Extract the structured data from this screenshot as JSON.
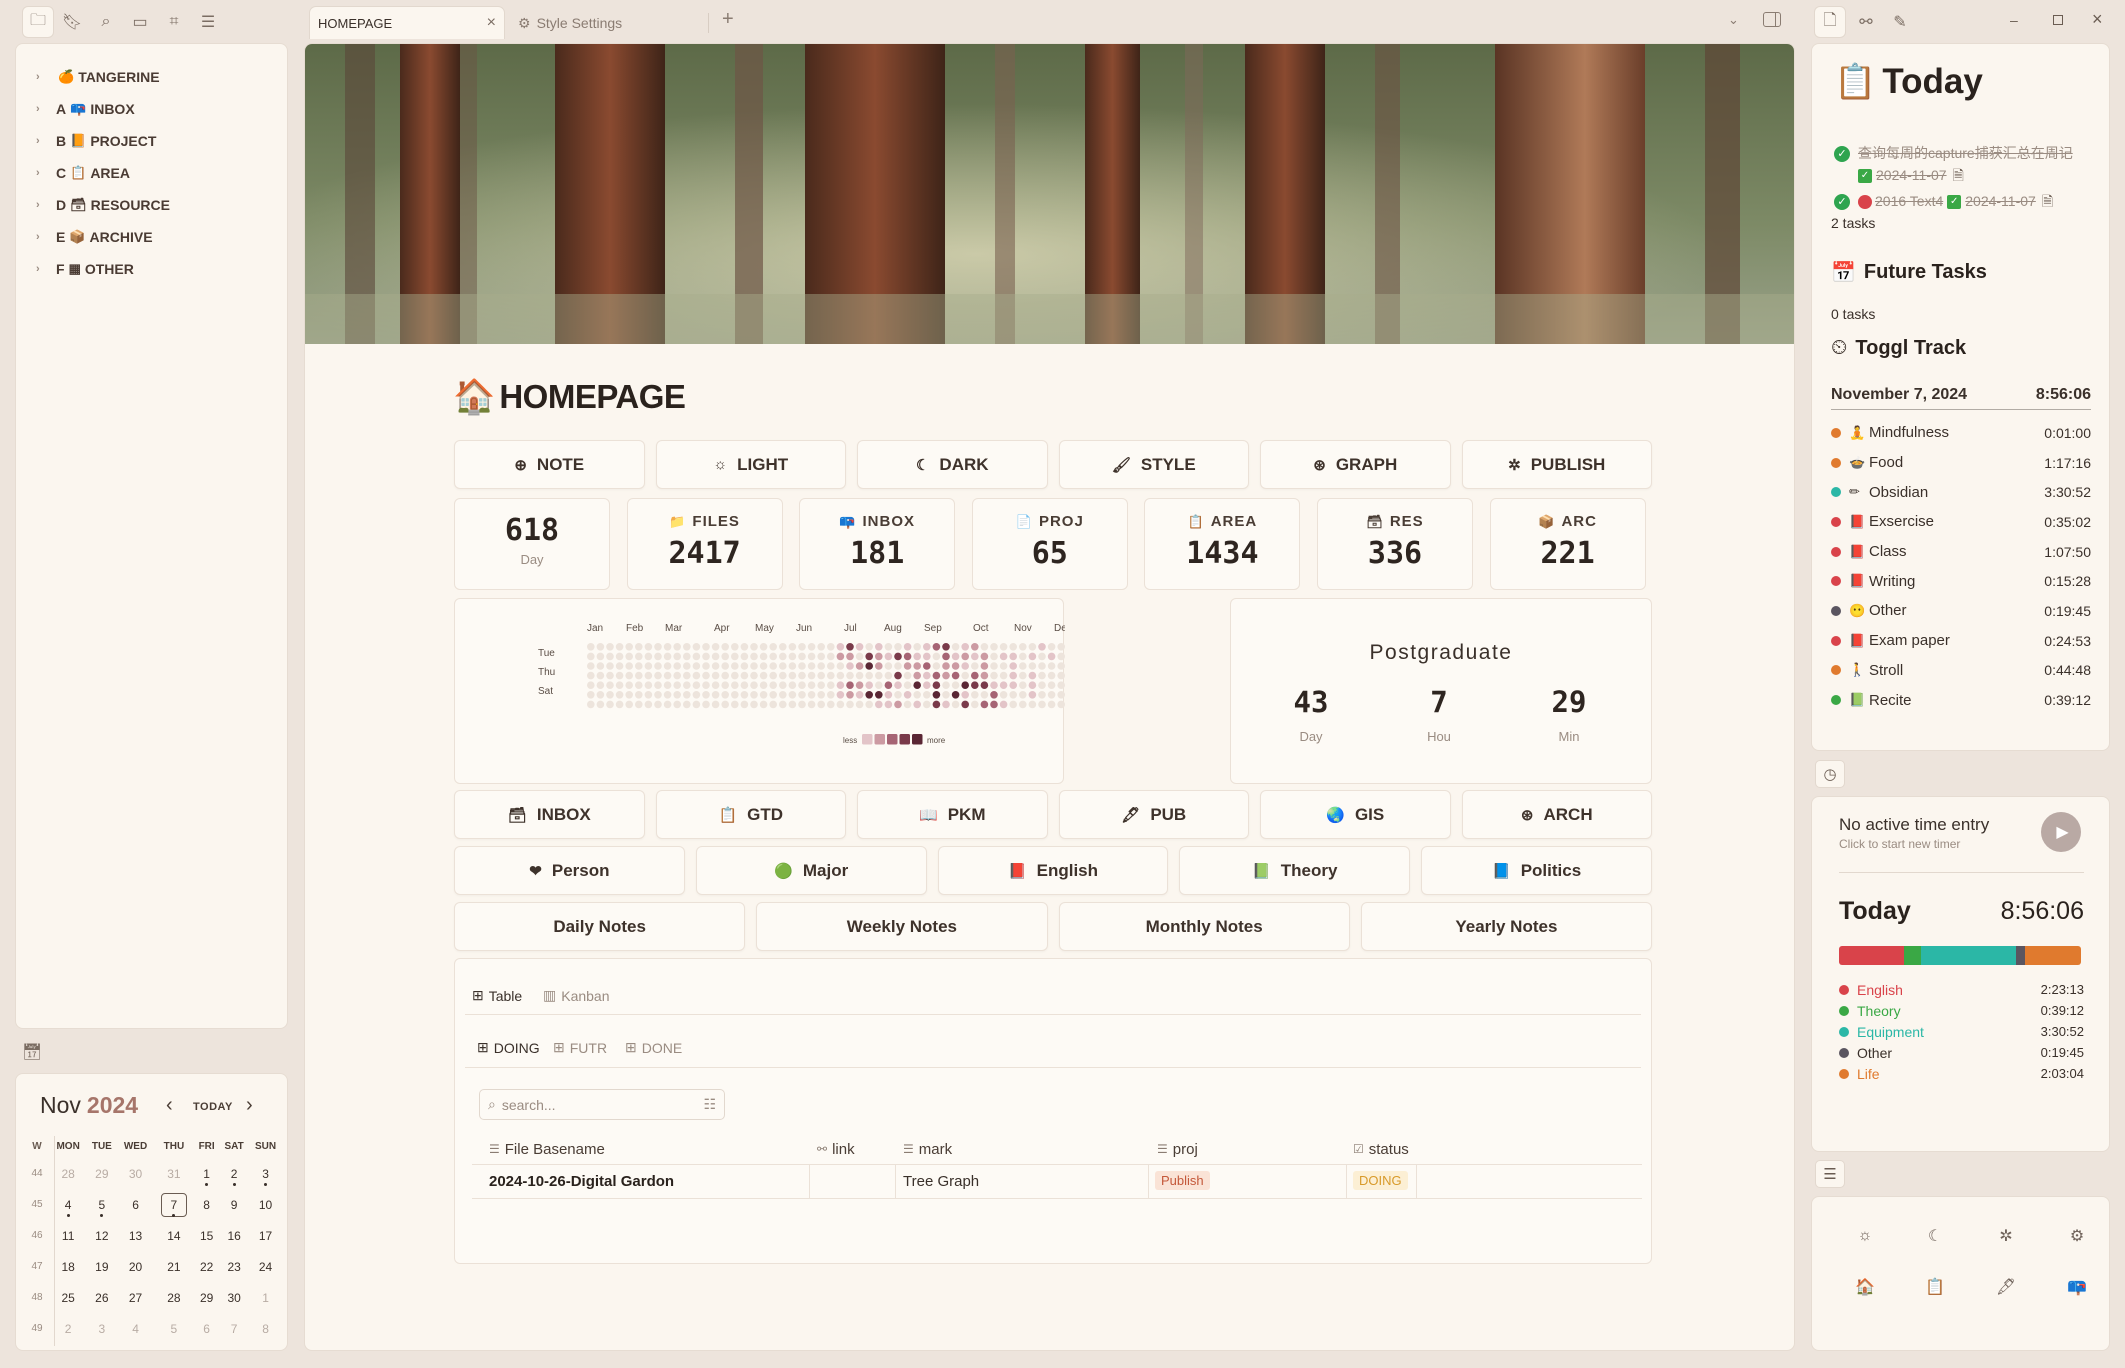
{
  "tabs": {
    "active": "HOMEPAGE",
    "inactive": "Style Settings",
    "close": "×",
    "add": "+",
    "settings_icon": "⚙"
  },
  "sidebar": {
    "items": [
      {
        "prefix": "",
        "emoji": "🍊",
        "label": "TANGERINE"
      },
      {
        "prefix": "A",
        "emoji": "📪",
        "label": "INBOX"
      },
      {
        "prefix": "B",
        "emoji": "📙",
        "label": "PROJECT"
      },
      {
        "prefix": "C",
        "emoji": "📋",
        "label": "AREA"
      },
      {
        "prefix": "D",
        "emoji": "🗃",
        "label": "RESOURCE"
      },
      {
        "prefix": "E",
        "emoji": "📦",
        "label": "ARCHIVE"
      },
      {
        "prefix": "F",
        "emoji": "▦",
        "label": "OTHER"
      }
    ]
  },
  "calendar": {
    "month": "Nov",
    "year": "2024",
    "today_btn": "TODAY",
    "week_header": "W",
    "days": [
      "MON",
      "TUE",
      "WED",
      "THU",
      "FRI",
      "SAT",
      "SUN"
    ],
    "weeks": [
      {
        "w": "44",
        "d": [
          "28",
          "29",
          "30",
          "31",
          "1",
          "2",
          "3"
        ]
      },
      {
        "w": "45",
        "d": [
          "4",
          "5",
          "6",
          "7",
          "8",
          "9",
          "10"
        ]
      },
      {
        "w": "46",
        "d": [
          "11",
          "12",
          "13",
          "14",
          "15",
          "16",
          "17"
        ]
      },
      {
        "w": "47",
        "d": [
          "18",
          "19",
          "20",
          "21",
          "22",
          "23",
          "24"
        ]
      },
      {
        "w": "48",
        "d": [
          "25",
          "26",
          "27",
          "28",
          "29",
          "30",
          "1"
        ]
      },
      {
        "w": "49",
        "d": [
          "2",
          "3",
          "4",
          "5",
          "6",
          "7",
          "8"
        ]
      }
    ]
  },
  "main": {
    "title": "HOMEPAGE",
    "title_emoji": "🏠",
    "buttons_row1": [
      {
        "icon": "⊕",
        "label": "NOTE"
      },
      {
        "icon": "☼",
        "label": "LIGHT"
      },
      {
        "icon": "☾",
        "label": "DARK"
      },
      {
        "icon": "🖌",
        "label": "STYLE"
      },
      {
        "icon": "⊛",
        "label": "GRAPH"
      },
      {
        "icon": "✲",
        "label": "PUBLISH"
      }
    ],
    "stats": [
      {
        "icon": "",
        "label": "",
        "value": "618",
        "sub": "Day"
      },
      {
        "icon": "📁",
        "label": "FILES",
        "value": "2417"
      },
      {
        "icon": "📪",
        "label": "INBOX",
        "value": "181"
      },
      {
        "icon": "📄",
        "label": "PROJ",
        "value": "65"
      },
      {
        "icon": "📋",
        "label": "AREA",
        "value": "1434"
      },
      {
        "icon": "🗃",
        "label": "RES",
        "value": "336"
      },
      {
        "icon": "📦",
        "label": "ARC",
        "value": "221"
      }
    ],
    "heatmap": {
      "months": [
        "Jan",
        "Feb",
        "Mar",
        "Apr",
        "May",
        "Jun",
        "Jul",
        "Aug",
        "Sep",
        "Oct",
        "Nov",
        "Dec"
      ],
      "rows": [
        "Tue",
        "Thu",
        "Sat"
      ],
      "less": "less",
      "more": "more"
    },
    "countdown": {
      "title": "Postgraduate",
      "items": [
        {
          "v": "43",
          "u": "Day"
        },
        {
          "v": "7",
          "u": "Hou"
        },
        {
          "v": "29",
          "u": "Min"
        }
      ]
    },
    "buttons_row2": [
      {
        "icon": "🗃",
        "label": "INBOX"
      },
      {
        "icon": "📋",
        "label": "GTD"
      },
      {
        "icon": "📖",
        "label": "PKM"
      },
      {
        "icon": "🖋",
        "label": "PUB"
      },
      {
        "icon": "🌏",
        "label": "GIS"
      },
      {
        "icon": "⊛",
        "label": "ARCH"
      }
    ],
    "buttons_row3": [
      {
        "icon": "❤",
        "label": "Person"
      },
      {
        "icon": "🟢",
        "label": "Major"
      },
      {
        "icon": "📕",
        "label": "English"
      },
      {
        "icon": "📗",
        "label": "Theory"
      },
      {
        "icon": "📘",
        "label": "Politics"
      }
    ],
    "buttons_row4": [
      {
        "label": "Daily Notes"
      },
      {
        "label": "Weekly Notes"
      },
      {
        "label": "Monthly Notes"
      },
      {
        "label": "Yearly Notes"
      }
    ],
    "views": {
      "table": "Table",
      "kanban": "Kanban"
    },
    "subtabs": [
      "DOING",
      "FUTR",
      "DONE"
    ],
    "search_placeholder": "search...",
    "columns": [
      "File Basename",
      "link",
      "mark",
      "proj",
      "status"
    ],
    "rows": [
      {
        "name": "2024-10-26-Digital Gardon",
        "link": "",
        "mark": "Tree Graph",
        "proj": "Publish",
        "status": "DOING"
      }
    ]
  },
  "right": {
    "today_title": "Today",
    "tasks": [
      {
        "text": "查询每周的capture捕获汇总在周记",
        "date": "2024-11-07"
      },
      {
        "text": "2016 Text4",
        "date": "2024-11-07"
      }
    ],
    "tasks_count": "2 tasks",
    "future_title": "Future Tasks",
    "future_count": "0 tasks",
    "toggl_title": "Toggl Track",
    "toggl_date": "November 7, 2024",
    "toggl_total": "8:56:06",
    "toggl_items": [
      {
        "c": "#e07a2e",
        "e": "🧘",
        "n": "Mindfulness",
        "t": "0:01:00"
      },
      {
        "c": "#e07a2e",
        "e": "🍲",
        "n": "Food",
        "t": "1:17:16"
      },
      {
        "c": "#2bb7a6",
        "e": "✏",
        "n": "Obsidian",
        "t": "3:30:52"
      },
      {
        "c": "#d9434a",
        "e": "📕",
        "n": "Exsercise",
        "t": "0:35:02"
      },
      {
        "c": "#d9434a",
        "e": "📕",
        "n": "Class",
        "t": "1:07:50"
      },
      {
        "c": "#d9434a",
        "e": "📕",
        "n": "Writing",
        "t": "0:15:28"
      },
      {
        "c": "#5a5560",
        "e": "😶",
        "n": "Other",
        "t": "0:19:45"
      },
      {
        "c": "#d9434a",
        "e": "📕",
        "n": "Exam paper",
        "t": "0:24:53"
      },
      {
        "c": "#e07a2e",
        "e": "🚶",
        "n": "Stroll",
        "t": "0:44:48"
      },
      {
        "c": "#3aa845",
        "e": "📗",
        "n": "Recite",
        "t": "0:39:12"
      }
    ],
    "timer_title": "No active time entry",
    "timer_sub": "Click to start new timer",
    "timer_today": "Today",
    "timer_total": "8:56:06",
    "legend": [
      {
        "c": "#d9434a",
        "n": "English",
        "t": "2:23:13",
        "f": 0.267
      },
      {
        "c": "#3aa845",
        "n": "Theory",
        "t": "0:39:12",
        "f": 0.073
      },
      {
        "c": "#2bb7a6",
        "n": "Equipment",
        "t": "3:30:52",
        "f": 0.393
      },
      {
        "c": "#5a5560",
        "n": "Other",
        "t": "0:19:45",
        "f": 0.037
      },
      {
        "c": "#e07a2e",
        "n": "Life",
        "t": "2:03:04",
        "f": 0.23
      }
    ]
  }
}
